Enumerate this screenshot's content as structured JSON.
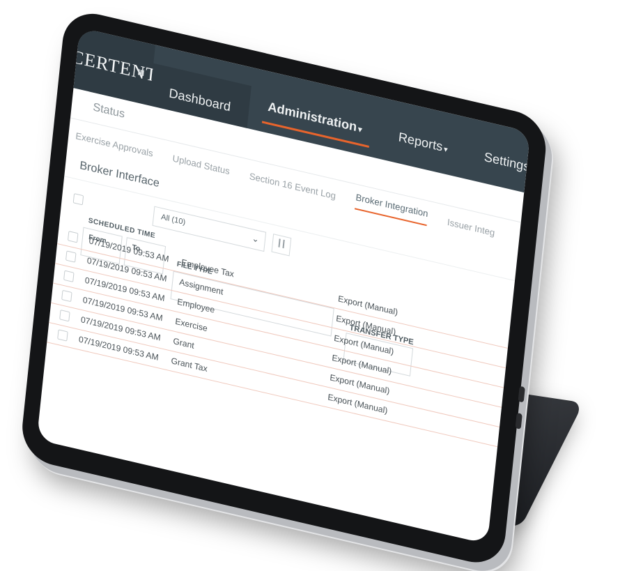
{
  "header": {
    "logo": "CERTENT",
    "nav": [
      {
        "label": "Dashboard",
        "caret": ""
      },
      {
        "label": "Administration",
        "caret": "▾"
      },
      {
        "label": "Reports",
        "caret": "▾"
      },
      {
        "label": "Settings",
        "caret": "▾"
      }
    ]
  },
  "status_label": "Status",
  "sub_nav": {
    "items": [
      "Exercise Approvals",
      "Upload Status",
      "Section 16 Event Log",
      "Broker Integration",
      "Issuer Integ"
    ],
    "active": "Broker Integration"
  },
  "page_title": "Broker Interface",
  "filters": {
    "select_value": "All (10)",
    "scheduled_time_label": "SCHEDULED TIME",
    "from_label": "From",
    "to_label": "To",
    "file_type_label": "FILE TYPE",
    "transfer_type_label": "TRANSFER TYPE"
  },
  "rows": [
    {
      "time": "07/19/2019 09:53 AM",
      "file_type": "Employee Tax",
      "transfer_type": "Export (Manual)"
    },
    {
      "time": "07/19/2019 09:53 AM",
      "file_type": "Assignment",
      "transfer_type": "Export (Manual)"
    },
    {
      "time": "07/19/2019 09:53 AM",
      "file_type": "Employee",
      "transfer_type": "Export (Manual)"
    },
    {
      "time": "07/19/2019 09:53 AM",
      "file_type": "Exercise",
      "transfer_type": "Export (Manual)"
    },
    {
      "time": "07/19/2019 09:53 AM",
      "file_type": "Grant",
      "transfer_type": "Export (Manual)"
    },
    {
      "time": "07/19/2019 09:53 AM",
      "file_type": "Grant Tax",
      "transfer_type": "Export (Manual)"
    }
  ],
  "colors": {
    "header_bg": "#37454e",
    "accent": "#e8642c",
    "device_body": "#141517"
  }
}
